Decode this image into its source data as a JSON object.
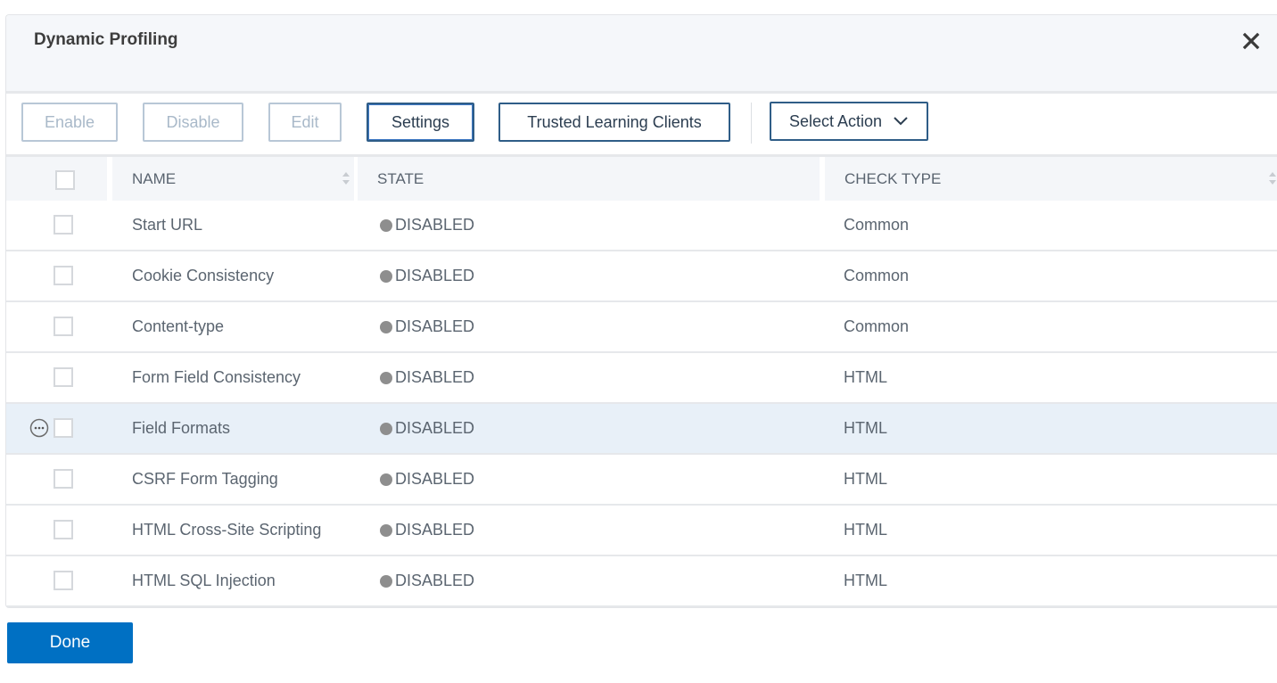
{
  "dialog": {
    "title": "Dynamic Profiling",
    "close_icon": "close-icon"
  },
  "toolbar": {
    "enable_label": "Enable",
    "disable_label": "Disable",
    "edit_label": "Edit",
    "settings_label": "Settings",
    "trusted_label": "Trusted Learning Clients",
    "select_action_label": "Select Action"
  },
  "table": {
    "columns": {
      "name": "NAME",
      "state": "STATE",
      "check_type": "CHECK TYPE"
    },
    "rows": [
      {
        "name": "Start URL",
        "state": "DISABLED",
        "check_type": "Common"
      },
      {
        "name": "Cookie Consistency",
        "state": "DISABLED",
        "check_type": "Common"
      },
      {
        "name": "Content-type",
        "state": "DISABLED",
        "check_type": "Common"
      },
      {
        "name": "Form Field Consistency",
        "state": "DISABLED",
        "check_type": "HTML"
      },
      {
        "name": "Field Formats",
        "state": "DISABLED",
        "check_type": "HTML"
      },
      {
        "name": "CSRF Form Tagging",
        "state": "DISABLED",
        "check_type": "HTML"
      },
      {
        "name": "HTML Cross-Site Scripting",
        "state": "DISABLED",
        "check_type": "HTML"
      },
      {
        "name": "HTML SQL Injection",
        "state": "DISABLED",
        "check_type": "HTML"
      }
    ],
    "hovered_row": 4
  },
  "footer": {
    "done_label": "Done"
  },
  "colors": {
    "primary": "#0070c3",
    "button_border": "#2f5d87",
    "status_disabled": "#8e8e8e",
    "hover_row": "#e8f0f8"
  }
}
